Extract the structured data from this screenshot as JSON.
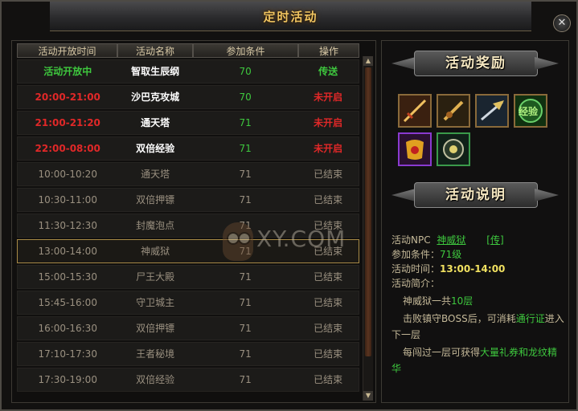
{
  "window": {
    "title": "定时活动",
    "close_glyph": "✕"
  },
  "table": {
    "headers": [
      "活动开放时间",
      "活动名称",
      "参加条件",
      "操作"
    ],
    "rows": [
      {
        "time": "活动开放中",
        "name": "智取生辰纲",
        "cond": "70",
        "op": "传送",
        "time_color": "#3ec83e",
        "name_color": "#ffffff",
        "cond_color": "#3ec83e",
        "op_color": "#3ec83e",
        "bold": true
      },
      {
        "time": "20:00-21:00",
        "name": "沙巴克攻城",
        "cond": "70",
        "op": "未开启",
        "time_color": "#e02828",
        "name_color": "#ffffff",
        "cond_color": "#3ec83e",
        "op_color": "#e02828",
        "bold": true
      },
      {
        "time": "21:00-21:20",
        "name": "通天塔",
        "cond": "71",
        "op": "未开启",
        "time_color": "#e02828",
        "name_color": "#ffffff",
        "cond_color": "#3ec83e",
        "op_color": "#e02828",
        "bold": true
      },
      {
        "time": "22:00-08:00",
        "name": "双倍经验",
        "cond": "71",
        "op": "未开启",
        "time_color": "#e02828",
        "name_color": "#ffffff",
        "cond_color": "#3ec83e",
        "op_color": "#e02828",
        "bold": true
      },
      {
        "time": "10:00-10:20",
        "name": "通天塔",
        "cond": "71",
        "op": "已结束",
        "time_color": "#9a9080",
        "name_color": "#9a9080",
        "cond_color": "#9a9080",
        "op_color": "#9a9080",
        "bold": false
      },
      {
        "time": "10:30-11:00",
        "name": "双倍押镖",
        "cond": "71",
        "op": "已结束",
        "time_color": "#9a9080",
        "name_color": "#9a9080",
        "cond_color": "#9a9080",
        "op_color": "#9a9080",
        "bold": false
      },
      {
        "time": "11:30-12:30",
        "name": "封魔泡点",
        "cond": "71",
        "op": "已结束",
        "time_color": "#9a9080",
        "name_color": "#9a9080",
        "cond_color": "#9a9080",
        "op_color": "#9a9080",
        "bold": false
      },
      {
        "time": "13:00-14:00",
        "name": "神威狱",
        "cond": "71",
        "op": "已结束",
        "time_color": "#9a9080",
        "name_color": "#9a9080",
        "cond_color": "#9a9080",
        "op_color": "#9a9080",
        "bold": false,
        "selected": true
      },
      {
        "time": "15:00-15:30",
        "name": "尸王大殿",
        "cond": "71",
        "op": "已结束",
        "time_color": "#9a9080",
        "name_color": "#9a9080",
        "cond_color": "#9a9080",
        "op_color": "#9a9080",
        "bold": false
      },
      {
        "time": "15:45-16:00",
        "name": "守卫城主",
        "cond": "71",
        "op": "已结束",
        "time_color": "#9a9080",
        "name_color": "#9a9080",
        "cond_color": "#9a9080",
        "op_color": "#9a9080",
        "bold": false
      },
      {
        "time": "16:00-16:30",
        "name": "双倍押镖",
        "cond": "71",
        "op": "已结束",
        "time_color": "#9a9080",
        "name_color": "#9a9080",
        "cond_color": "#9a9080",
        "op_color": "#9a9080",
        "bold": false
      },
      {
        "time": "17:10-17:30",
        "name": "王者秘境",
        "cond": "71",
        "op": "已结束",
        "time_color": "#9a9080",
        "name_color": "#9a9080",
        "cond_color": "#9a9080",
        "op_color": "#9a9080",
        "bold": false
      },
      {
        "time": "17:30-19:00",
        "name": "双倍经验",
        "cond": "71",
        "op": "已结束",
        "time_color": "#9a9080",
        "name_color": "#9a9080",
        "cond_color": "#9a9080",
        "op_color": "#9a9080",
        "bold": false
      }
    ]
  },
  "watermark": {
    "text": "XY.COM"
  },
  "rewards_section": {
    "title": "活动奖励",
    "items": [
      {
        "icon": "sword-icon",
        "border": "#c08a3a"
      },
      {
        "icon": "sword-icon",
        "border": "#c08a3a"
      },
      {
        "icon": "spear-icon",
        "border": "#c08a3a"
      },
      {
        "icon": "exp-icon",
        "border": "#c08a3a",
        "label": "经验"
      },
      {
        "icon": "scroll-icon",
        "border": "#8a3ad0"
      },
      {
        "icon": "token-icon",
        "border": "#3a9a4a"
      }
    ]
  },
  "description_section": {
    "title": "活动说明",
    "npc_label": "活动NPC",
    "npc_name": "神威狱",
    "npc_teleport": "[传]",
    "cond_label": "参加条件：",
    "cond_value": "71级",
    "time_label": "活动时间：",
    "time_value": "13:00-14:00",
    "intro_label": "活动简介：",
    "line1_a": "神威狱一共",
    "line1_b": "10层",
    "line2_a": "击败镇守BOSS后，可消耗",
    "line2_b": "通行证",
    "line2_c": "进入",
    "line3": "下一层",
    "line4_a": "每闯过一层可获得",
    "line4_b": "大量礼券和龙纹精",
    "line5": "华"
  },
  "colors": {
    "accent_gold": "#f0c460",
    "green": "#3ec83e",
    "red": "#e02828",
    "yellow": "#f0e060"
  }
}
